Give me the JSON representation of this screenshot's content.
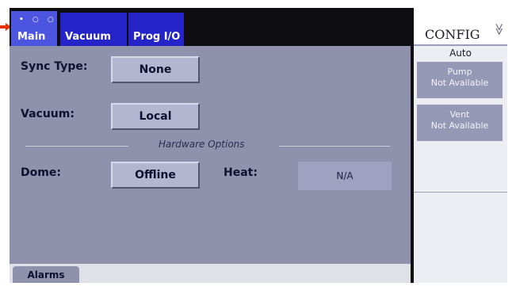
{
  "tabs": {
    "main_dots": "• ○ ○",
    "main": "Main",
    "vacuum": "Vacuum",
    "prog_io": "Prog I/O"
  },
  "settings": {
    "sync_type_label": "Sync Type:",
    "sync_type_value": "None",
    "vacuum_label": "Vacuum:",
    "vacuum_value": "Local",
    "hardware_options_title": "Hardware Options",
    "dome_label": "Dome:",
    "dome_value": "Offline",
    "heat_label": "Heat:",
    "heat_value": "N/A"
  },
  "bottom": {
    "alarms": "Alarms"
  },
  "sidebar": {
    "config_title": "CONFIG",
    "config_chevron": "≫",
    "mode": "Auto",
    "pump_title": "Pump",
    "pump_status": "Not Available",
    "vent_title": "Vent",
    "vent_status": "Not Available"
  },
  "colors": {
    "tab_active": "#4b55e0",
    "tab": "#2424c8",
    "panel": "#8e92ad",
    "button": "#b3b6d0",
    "status_box": "#9599b5",
    "pointer_arrow": "#e8320a"
  }
}
